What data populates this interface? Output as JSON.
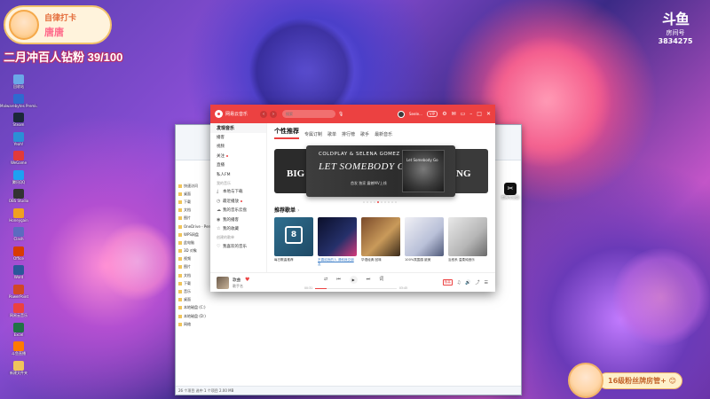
{
  "overlay": {
    "channel_title": "自律打卡",
    "streamer_name": "唐唐",
    "goal_text": "二月冲百人钻粉 39/100",
    "platform_logo": "斗鱼",
    "room_label": "房间号",
    "room_id": "3834275",
    "fans_text": "16级粉丝牌房管+",
    "fans_emoji": "😊"
  },
  "desktop_icons": [
    {
      "label": "回收站",
      "icon": "recycle-bin-icon",
      "color": "#6aa8e8"
    },
    {
      "label": "Malwarebytes Premium",
      "icon": "malwarebytes-icon",
      "color": "#2f6ad0"
    },
    {
      "label": "Steam",
      "icon": "steam-icon",
      "color": "#1b2838"
    },
    {
      "label": "Yeah!",
      "icon": "app-icon",
      "color": "#2b8fd6"
    },
    {
      "label": "WeGame",
      "icon": "wegame-icon",
      "color": "#e23a3a"
    },
    {
      "label": "腾讯QQ",
      "icon": "qq-icon",
      "color": "#1ea1f2"
    },
    {
      "label": "OBS Studio",
      "icon": "obs-icon",
      "color": "#333333"
    },
    {
      "label": "Honeygain",
      "icon": "app-icon",
      "color": "#f0a020"
    },
    {
      "label": "Clash",
      "icon": "app-icon",
      "color": "#5c6bc0"
    },
    {
      "label": "Office",
      "icon": "office-icon",
      "color": "#d83b01"
    },
    {
      "label": "Word",
      "icon": "word-icon",
      "color": "#2b579a"
    },
    {
      "label": "PowerPoint",
      "icon": "powerpoint-icon",
      "color": "#d24726"
    },
    {
      "label": "网易云音乐",
      "icon": "netease-icon",
      "color": "#ec4141"
    },
    {
      "label": "Excel",
      "icon": "excel-icon",
      "color": "#217346"
    },
    {
      "label": "斗鱼直播",
      "icon": "douyu-icon",
      "color": "#ff7a00"
    },
    {
      "label": "新建文件夹",
      "icon": "folder-icon",
      "color": "#f0c45a"
    }
  ],
  "explorer": {
    "side_items": [
      "快速访问",
      "桌面",
      "下载",
      "文档",
      "图片",
      "OneDrive - Perso",
      "WPS网盘",
      "此电脑",
      "3D 对象",
      "视频",
      "图片",
      "文档",
      "下载",
      "音乐",
      "桌面",
      "本地磁盘 (C:)",
      "本地磁盘 (D:)",
      "网络"
    ],
    "status": "26 个项目    选中 1 个项目  2.00 MB"
  },
  "right_app": {
    "label": "剪映专业版"
  },
  "player": {
    "app_name": "网易云音乐",
    "search_placeholder": "搜索",
    "user_name": "Seele...",
    "vip": "VIP",
    "sidebar": [
      {
        "label": "发现音乐",
        "active": true,
        "type": "item"
      },
      {
        "label": "播客",
        "type": "item"
      },
      {
        "label": "视频",
        "type": "item"
      },
      {
        "label": "关注",
        "type": "item",
        "dot": true
      },
      {
        "label": "直播",
        "type": "item"
      },
      {
        "label": "私人FM",
        "type": "item"
      },
      {
        "label": "我的音乐",
        "type": "section"
      },
      {
        "label": "本地与下载",
        "type": "item",
        "glyph": "⤓"
      },
      {
        "label": "最近播放",
        "type": "item",
        "glyph": "◷",
        "dot": true
      },
      {
        "label": "我的音乐云盘",
        "type": "item",
        "glyph": "☁"
      },
      {
        "label": "我的播客",
        "type": "item",
        "glyph": "◉"
      },
      {
        "label": "我的收藏",
        "type": "item",
        "glyph": "☆"
      },
      {
        "label": "创建的歌单",
        "type": "section"
      },
      {
        "label": "我喜欢的音乐",
        "type": "item",
        "glyph": "♡"
      }
    ],
    "tabs": [
      "个性推荐",
      "专属订制",
      "歌单",
      "排行榜",
      "歌手",
      "最新音乐"
    ],
    "banner": {
      "left_text": "BIG",
      "artist": "COLDPLAY & SELENA GOMEZ",
      "song": "LET SOMEBODY GO",
      "subtitle": "首发  独家  震撼MV上线",
      "cover_label": "Let Somebody Go",
      "right_text": "NG"
    },
    "banner_dot_count": 10,
    "banner_dot_active": 4,
    "section_title": "推荐歌单",
    "section_chevron": "›",
    "playlists": [
      {
        "title": "每日歌曲推荐",
        "date": "8",
        "kind": "daily",
        "link": false
      },
      {
        "title": "不喜欢我的人 请和我交朋友",
        "kind": "neon",
        "link": true
      },
      {
        "title": "华语经典 回味",
        "kind": "room",
        "link": false
      },
      {
        "title": "100%氛围感 欧美",
        "kind": "anime",
        "link": false
      },
      {
        "title": "治愈系 温柔纯音乐",
        "kind": "sketch",
        "link": false
      }
    ],
    "now_playing": {
      "title": "歌曲",
      "artist": "歌手名",
      "time_current": "00:31",
      "time_total": "03:45",
      "progress": 0.14
    },
    "controls": {
      "shuffle": "⇄",
      "prev": "⏮",
      "play": "▶",
      "next": "⏭",
      "lyric": "词"
    },
    "quality": "极高"
  }
}
